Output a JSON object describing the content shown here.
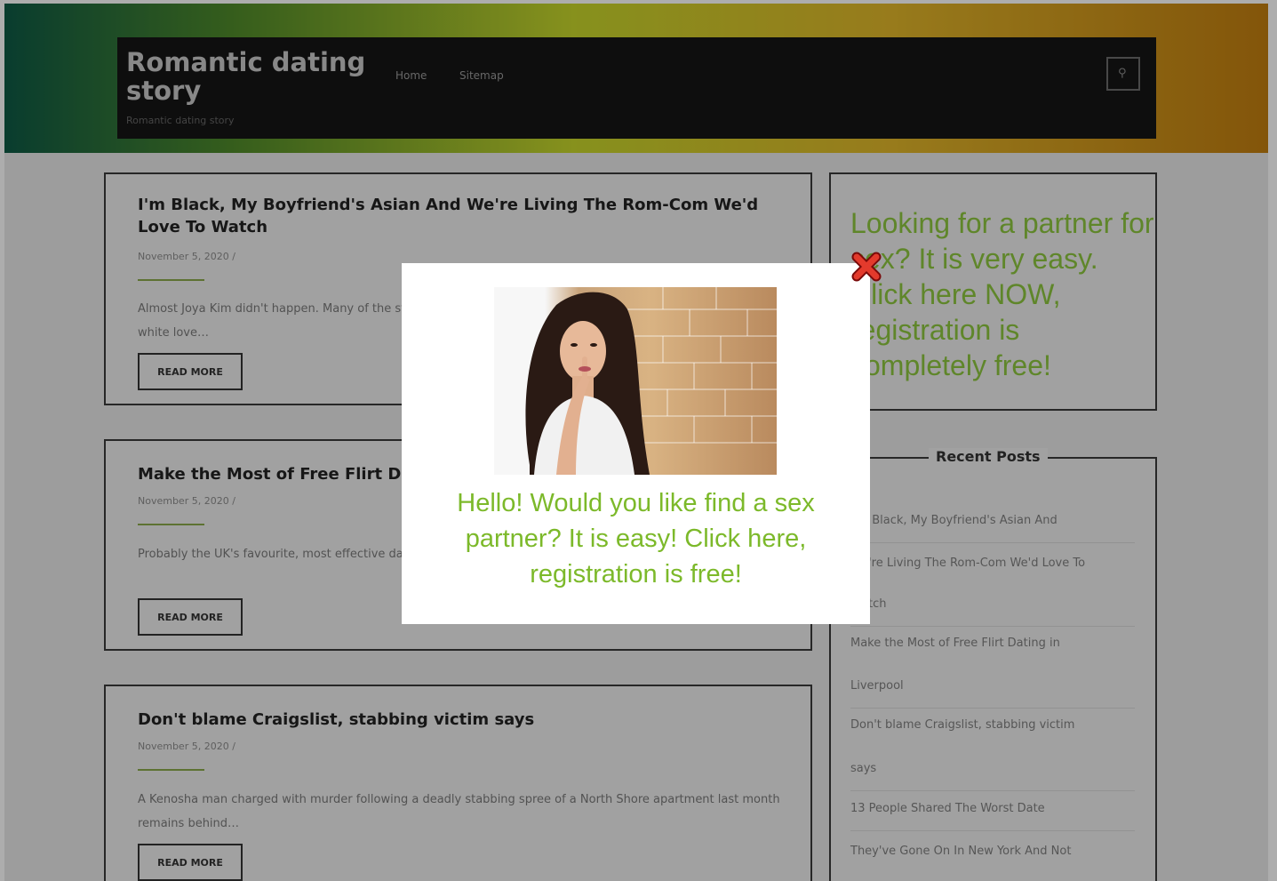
{
  "site": {
    "title": "Romantic dating story",
    "tagline": "Romantic dating story",
    "nav": [
      "Home",
      "Sitemap"
    ]
  },
  "posts": [
    {
      "title": "I'm Black, My Boyfriend's Asian And We're Living The Rom-Com We'd Love To Watch",
      "date": "November 5, 2020 /",
      "excerpt": "Almost Joya Kim didn't happen. Many of the stories we celebrate from modern movies and books are still about white love…",
      "read_more": "READ MORE"
    },
    {
      "title": "Make the Most of Free Flirt Dating in Liverpool",
      "date": "November 5, 2020 /",
      "excerpt": "Probably the UK's favourite, most effective dating site for singles over 50 in the…",
      "read_more": "READ MORE"
    },
    {
      "title": "Don't blame Craigslist, stabbing victim says",
      "date": "November 5, 2020 /",
      "excerpt": "A Kenosha man charged with murder following a deadly stabbing spree of a North Shore apartment last month remains behind…",
      "read_more": "READ MORE"
    }
  ],
  "sidebar": {
    "cta_text": "Looking for a partner for sex? It is very easy. Click here NOW, registration is completely free!",
    "recent_heading": "Recent Posts",
    "recent_items": [
      "I'm Black, My Boyfriend's Asian And",
      "We're Living The Rom-Com We'd Love To",
      "Watch",
      "Make the Most of Free Flirt Dating in",
      "Liverpool",
      "Don't blame Craigslist, stabbing victim",
      "says",
      "13 People Shared The Worst Date",
      "They've Gone On In New York And Not"
    ]
  },
  "popup": {
    "message": "Hello! Would you like find a sex partner? It is easy! Click here, registration is free!",
    "accent_color": "#7cb92a",
    "close_icon": "close-icon",
    "image_alt": "woman-photo"
  }
}
